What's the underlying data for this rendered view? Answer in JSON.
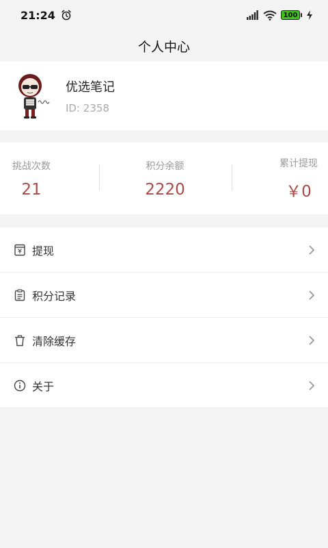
{
  "status_bar": {
    "time": "21:24",
    "battery": "100",
    "icons": [
      "alarm-icon",
      "signal-icon",
      "wifi-icon",
      "battery-icon",
      "charging-icon"
    ]
  },
  "header": {
    "title": "个人中心"
  },
  "profile": {
    "name": "优选笔记",
    "id_text": "ID: 2358"
  },
  "stats": {
    "challenges": {
      "label": "挑战次数",
      "value": "21"
    },
    "points": {
      "label": "积分余额",
      "value": "2220"
    },
    "withdrawn": {
      "label": "累计提现",
      "value": "￥0"
    }
  },
  "menu": {
    "items": [
      {
        "label": "提现",
        "icon": "wallet-icon"
      },
      {
        "label": "积分记录",
        "icon": "clipboard-icon"
      },
      {
        "label": "清除缓存",
        "icon": "trash-icon"
      },
      {
        "label": "关于",
        "icon": "info-icon"
      }
    ]
  },
  "colors": {
    "accent": "#a94a47",
    "background": "#f3f3f3",
    "battery": "#3cc21a"
  }
}
